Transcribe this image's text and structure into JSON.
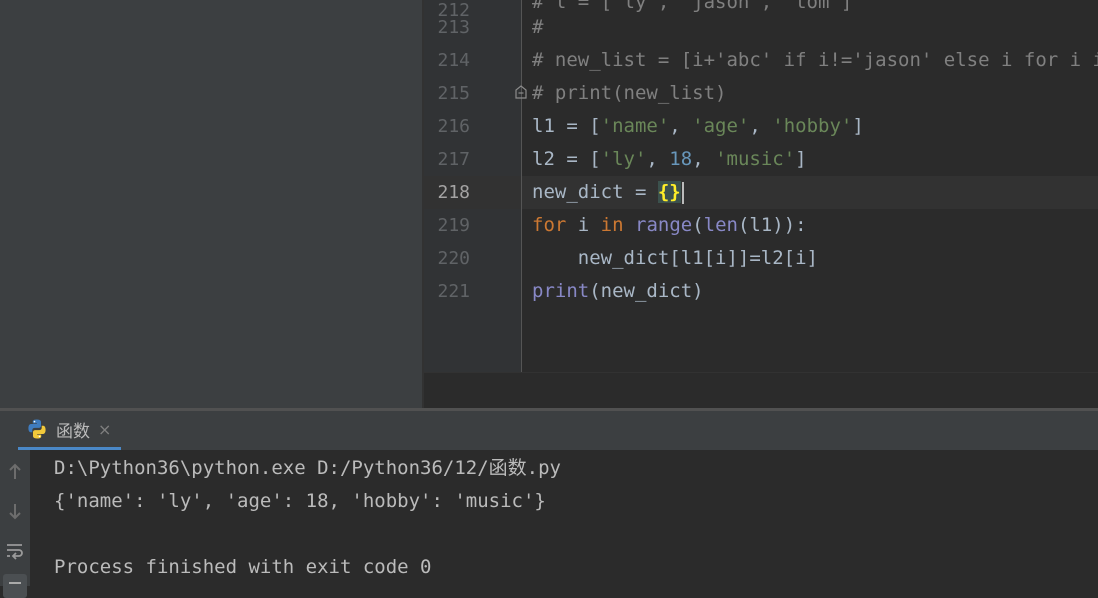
{
  "editor": {
    "lines": [
      {
        "num": "212",
        "text": "# l = ['ly', 'jason', 'tom']"
      },
      {
        "num": "213",
        "text": "#"
      },
      {
        "num": "214",
        "text": "# new_list = [i+'abc' if i!='jason' else i for i in l]"
      },
      {
        "num": "215",
        "text": "# print(new_list)"
      },
      {
        "num": "216",
        "text": "l1 = ['name', 'age', 'hobby']"
      },
      {
        "num": "217",
        "text": "l2 = ['ly', 18, 'music']"
      },
      {
        "num": "218",
        "text": "new_dict = {}"
      },
      {
        "num": "219",
        "text": "for i in range(len(l1)):"
      },
      {
        "num": "220",
        "text": "    new_dict[l1[i]]=l2[i]"
      },
      {
        "num": "221",
        "text": "print(new_dict)"
      }
    ],
    "active_line": "218"
  },
  "run": {
    "tab_label": "函数",
    "close_glyph": "×"
  },
  "console": {
    "lines": [
      "D:\\Python36\\python.exe D:/Python36/12/函数.py",
      "{'name': 'ly', 'age': 18, 'hobby': 'music'}",
      "",
      "Process finished with exit code 0"
    ]
  },
  "colors": {
    "keyword": "#cc7832",
    "string": "#6a8759",
    "number": "#6897bb",
    "builtin": "#8888c6",
    "comment": "#808080",
    "tab_accent": "#4a88c7"
  },
  "icons": {
    "run_tab": "python-icon",
    "toolbar": [
      "arrow-up-icon",
      "arrow-down-icon",
      "soft-wrap-icon"
    ]
  }
}
